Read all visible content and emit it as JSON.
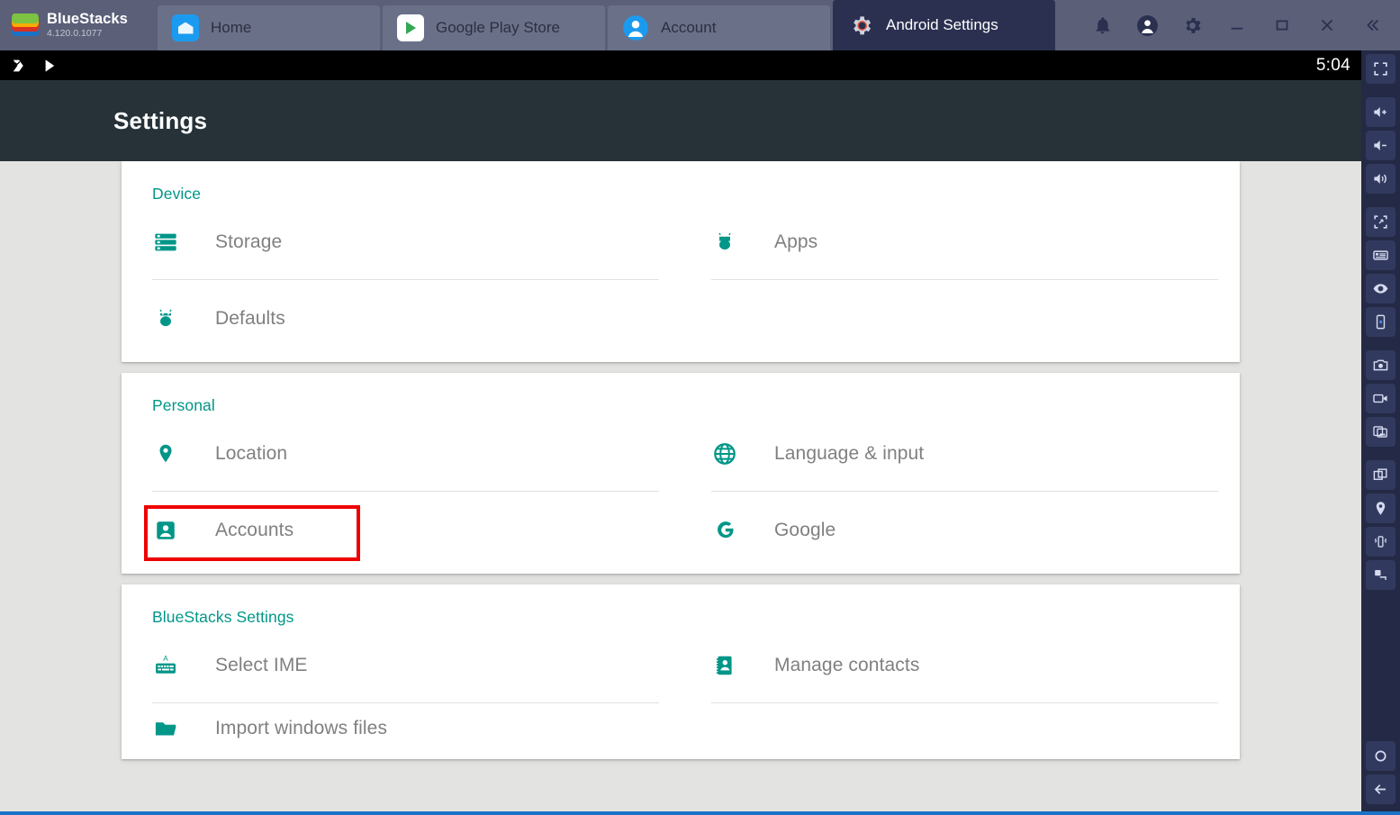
{
  "window": {
    "brand_name": "BlueStacks",
    "brand_version": "4.120.0.1077",
    "tabs": [
      {
        "label": "Home",
        "icon": "home-icon",
        "active": false
      },
      {
        "label": "Google Play Store",
        "icon": "google-play-icon",
        "active": false
      },
      {
        "label": "Account",
        "icon": "account-avatar-icon",
        "active": false
      },
      {
        "label": "Android Settings",
        "icon": "gear-icon",
        "active": true
      }
    ],
    "controls": [
      {
        "name": "notifications-button",
        "icon": "bell-icon"
      },
      {
        "name": "profile-button",
        "icon": "user-circle-icon"
      },
      {
        "name": "settings-button",
        "icon": "gear-icon"
      },
      {
        "name": "minimize-button",
        "icon": "minimize-icon"
      },
      {
        "name": "maximize-button",
        "icon": "maximize-icon"
      },
      {
        "name": "close-button",
        "icon": "close-icon"
      },
      {
        "name": "collapse-sidebar-button",
        "icon": "double-chevron-left-icon"
      }
    ]
  },
  "statusbar": {
    "icons": [
      "bluestacks-notification-icon",
      "google-play-notification-icon"
    ],
    "time": "5:04"
  },
  "header": {
    "title": "Settings"
  },
  "sections": [
    {
      "title": "Device",
      "items": [
        {
          "label": "Storage",
          "icon": "storage-icon"
        },
        {
          "label": "Apps",
          "icon": "android-robot-icon"
        },
        {
          "label": "Defaults",
          "icon": "android-robot-icon"
        }
      ]
    },
    {
      "title": "Personal",
      "items": [
        {
          "label": "Location",
          "icon": "location-pin-icon"
        },
        {
          "label": "Language & input",
          "icon": "globe-icon"
        },
        {
          "label": "Accounts",
          "icon": "account-box-icon",
          "highlighted": true
        },
        {
          "label": "Google",
          "icon": "google-g-icon"
        }
      ]
    },
    {
      "title": "BlueStacks Settings",
      "items": [
        {
          "label": "Select IME",
          "icon": "keyboard-icon"
        },
        {
          "label": "Manage contacts",
          "icon": "contacts-book-icon"
        },
        {
          "label": "Import windows files",
          "icon": "folder-icon"
        }
      ]
    }
  ],
  "sidebar": {
    "items": [
      {
        "name": "fullscreen-button",
        "icon": "fullscreen-icon"
      },
      {
        "name": "volume-up-button",
        "icon": "volume-up-icon"
      },
      {
        "name": "volume-down-button",
        "icon": "volume-down-icon"
      },
      {
        "name": "volume-button",
        "icon": "speaker-icon"
      },
      {
        "name": "rotate-button",
        "icon": "rotate-screen-icon"
      },
      {
        "name": "keyboard-controls-button",
        "icon": "keyboard-icon"
      },
      {
        "name": "eye-dropper-button",
        "icon": "eye-icon"
      },
      {
        "name": "tilt-button",
        "icon": "phone-tilt-icon"
      },
      {
        "name": "screenshot-button",
        "icon": "camera-icon"
      },
      {
        "name": "record-button",
        "icon": "video-camera-icon"
      },
      {
        "name": "media-manager-button",
        "icon": "gallery-icon"
      },
      {
        "name": "multi-instance-button",
        "icon": "copy-windows-icon"
      },
      {
        "name": "location-button",
        "icon": "location-pin-icon"
      },
      {
        "name": "shake-button",
        "icon": "shake-device-icon"
      },
      {
        "name": "macro-button",
        "icon": "macro-icon"
      },
      {
        "name": "home-button",
        "icon": "circle-home-icon"
      },
      {
        "name": "back-button",
        "icon": "back-arrow-icon"
      }
    ]
  },
  "colors": {
    "accent_teal": "#009688",
    "highlight_red": "#ee0000",
    "titlebar": "#5b6078",
    "active_tab": "#2b3050",
    "header_dark": "#263238",
    "content_bg": "#e3e3e1"
  }
}
